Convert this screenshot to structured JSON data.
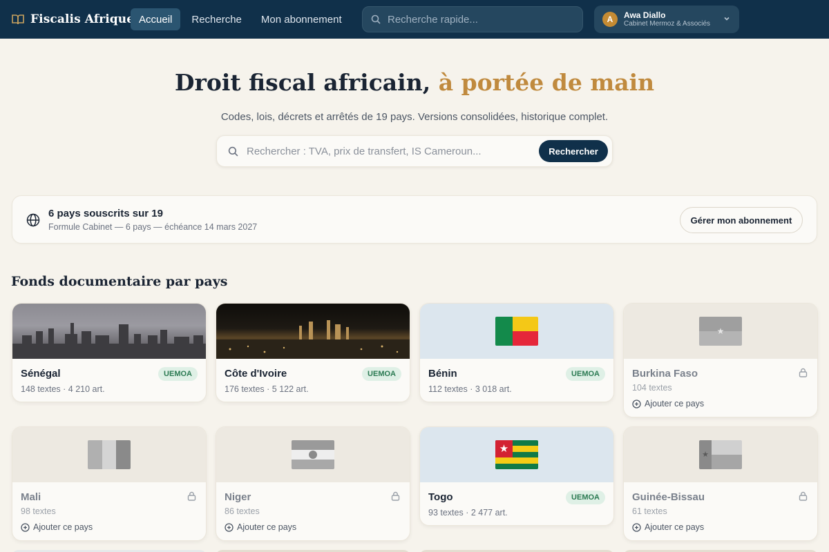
{
  "app": {
    "brand": "Fiscalis Afrique",
    "nav": [
      {
        "label": "Accueil",
        "active": true
      },
      {
        "label": "Recherche",
        "active": false
      },
      {
        "label": "Mon abonnement",
        "active": false
      }
    ],
    "quick_search_placeholder": "Recherche rapide...",
    "user": {
      "initial": "A",
      "name": "Awa Diallo",
      "org": "Cabinet Mermoz & Associés"
    }
  },
  "hero": {
    "title_main": "Droit fiscal africain,",
    "title_accent": "à portée de main",
    "subtitle": "Codes, lois, décrets et arrêtés de 19 pays. Versions consolidées, historique complet.",
    "search_placeholder": "Rechercher : TVA, prix de transfert, IS Cameroun...",
    "search_button": "Rechercher"
  },
  "subscription": {
    "title": "6 pays souscrits sur 19",
    "detail": "Formule Cabinet — 6 pays — échéance 14 mars 2027",
    "manage_button": "Gérer mon abonnement"
  },
  "section_title": "Fonds documentaire par pays",
  "countries": [
    {
      "name": "Sénégal",
      "meta": "148 textes · 4 210 art.",
      "badge": "UEMOA",
      "subscribed": true
    },
    {
      "name": "Côte d'Ivoire",
      "meta": "176 textes · 5 122 art.",
      "badge": "UEMOA",
      "subscribed": true
    },
    {
      "name": "Bénin",
      "meta": "112 textes · 3 018 art.",
      "badge": "UEMOA",
      "subscribed": true
    },
    {
      "name": "Burkina Faso",
      "meta": "104 textes",
      "add": "Ajouter ce pays",
      "subscribed": false
    },
    {
      "name": "Mali",
      "meta": "98 textes",
      "add": "Ajouter ce pays",
      "subscribed": false
    },
    {
      "name": "Niger",
      "meta": "86 textes",
      "add": "Ajouter ce pays",
      "subscribed": false
    },
    {
      "name": "Togo",
      "meta": "93 textes · 2 477 art.",
      "badge": "UEMOA",
      "subscribed": true
    },
    {
      "name": "Guinée-Bissau",
      "meta": "61 textes",
      "add": "Ajouter ce pays",
      "subscribed": false
    }
  ],
  "colors": {
    "navy": "#10304a",
    "accent": "#c08a3e",
    "badge_bg": "#dff0e6",
    "badge_text": "#2b7a52"
  }
}
